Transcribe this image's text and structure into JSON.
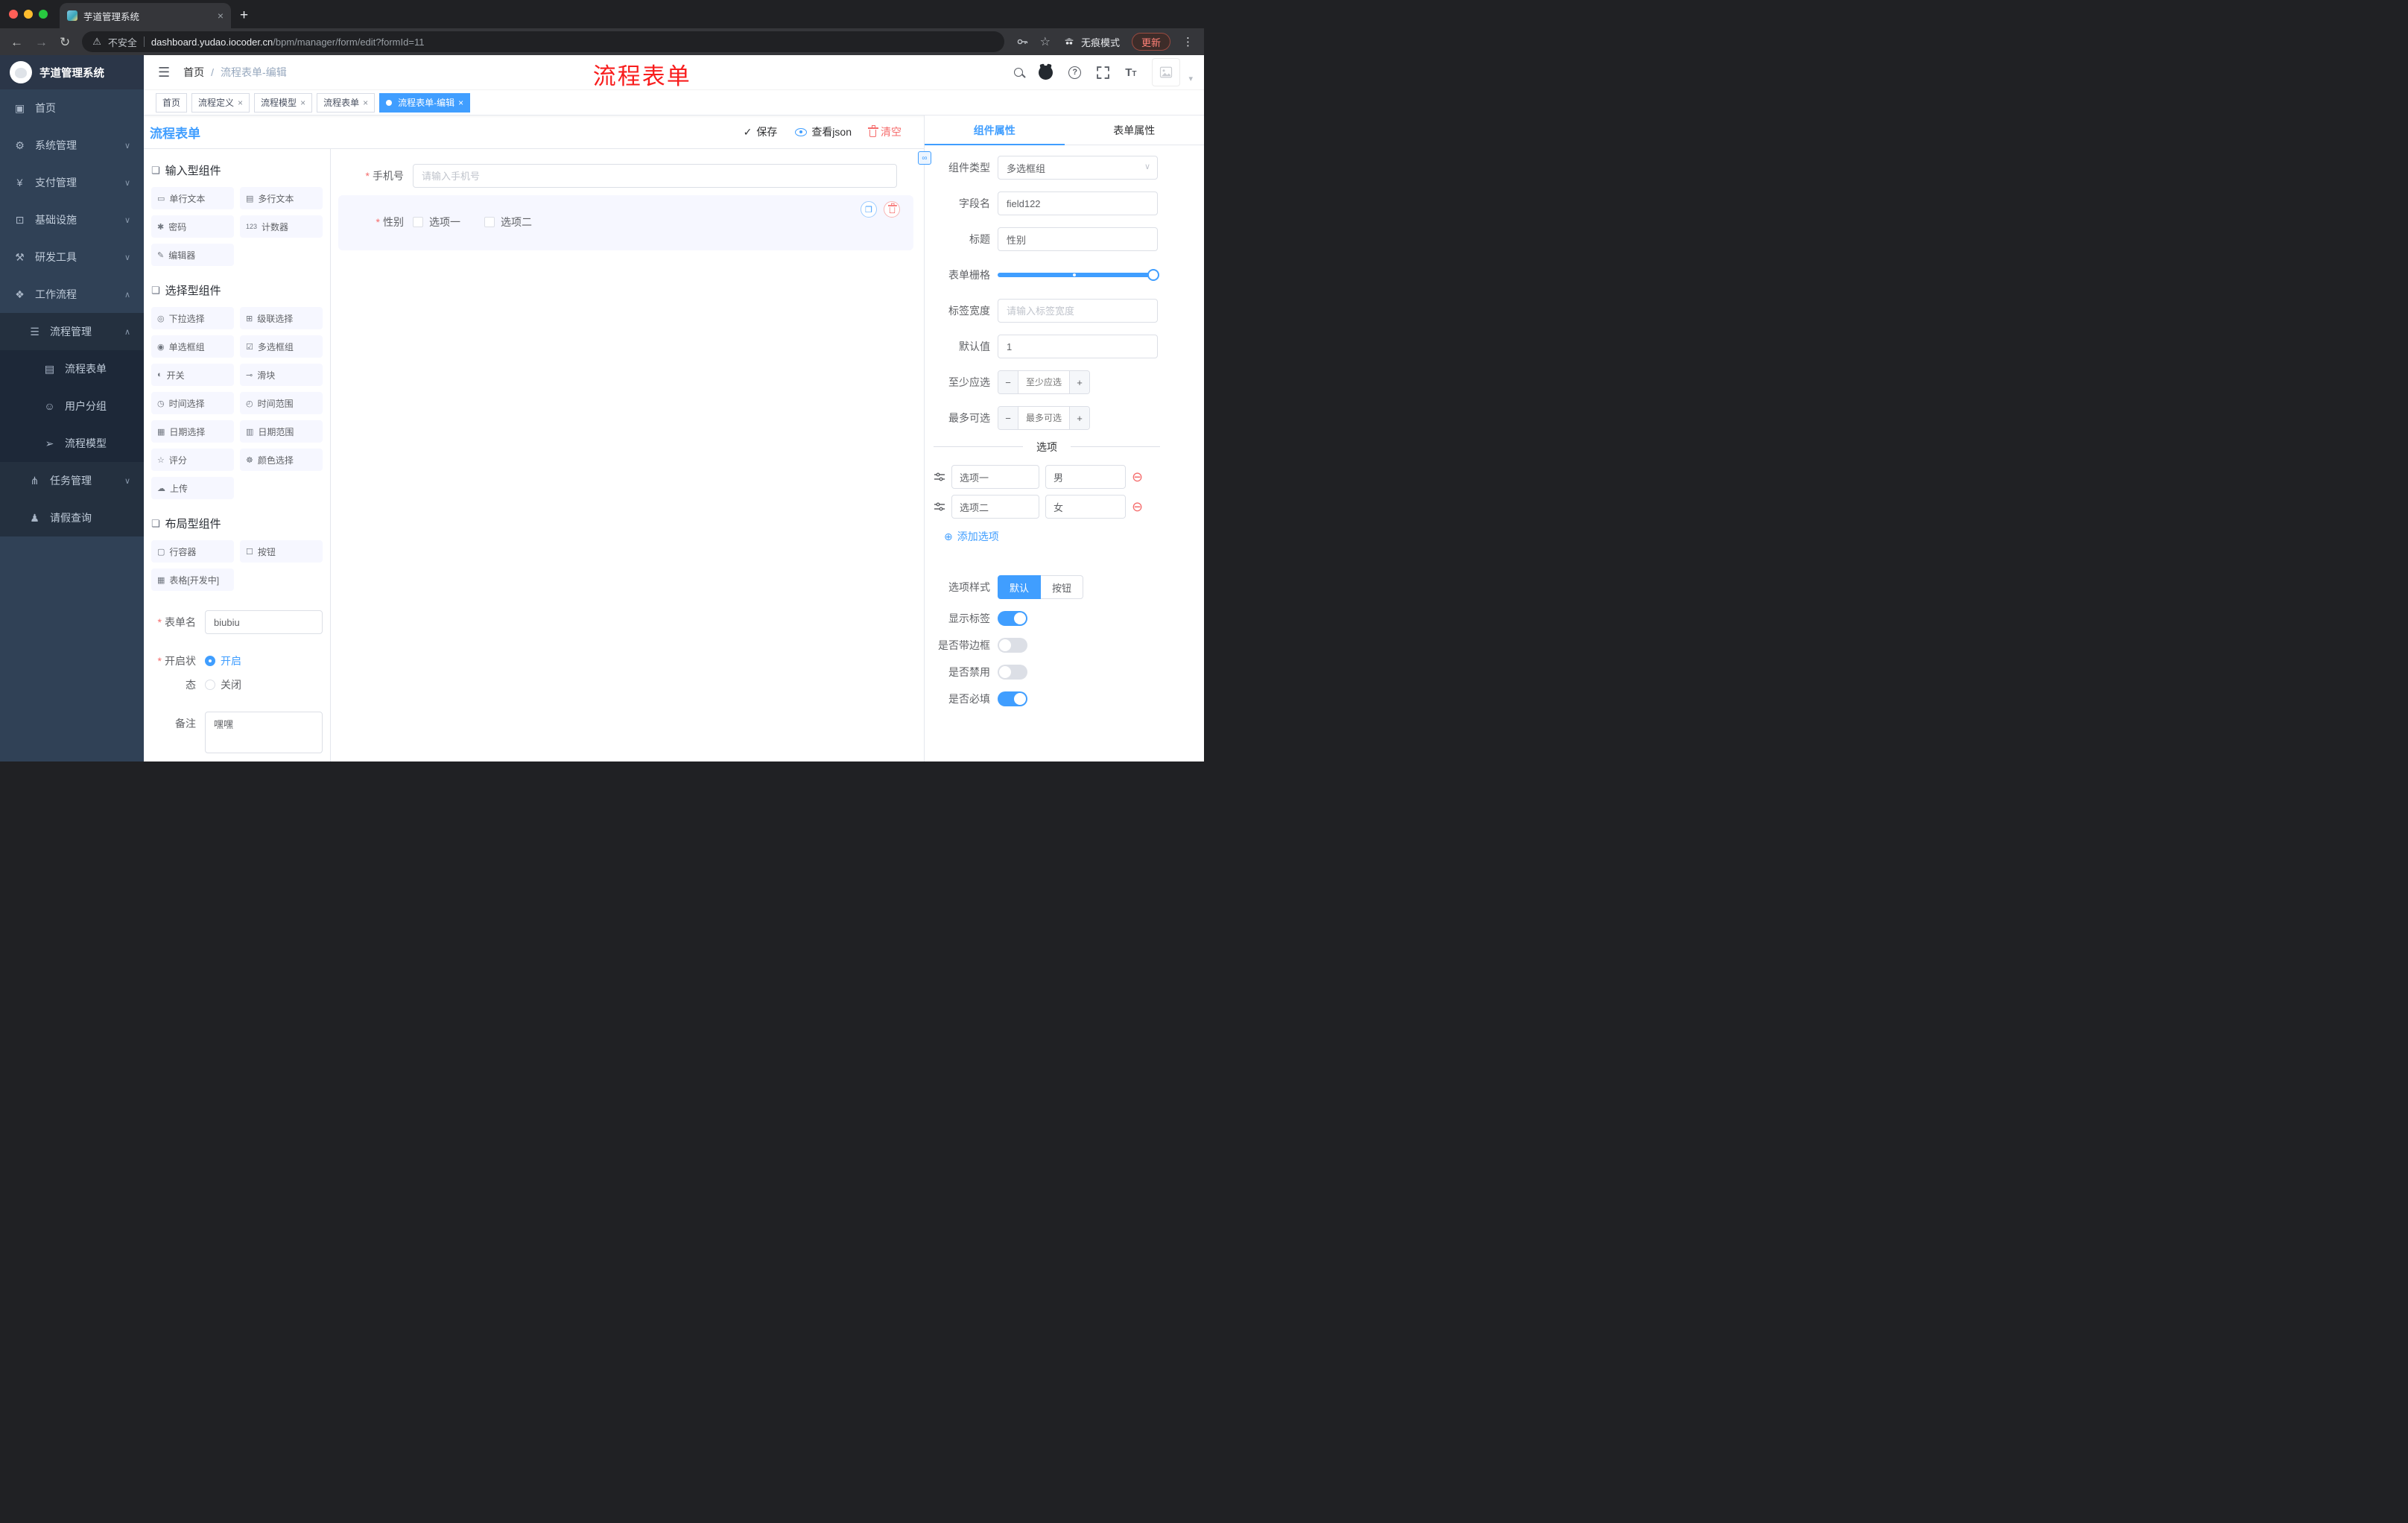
{
  "colors": {
    "accent": "#409eff",
    "danger": "#f56c6c",
    "annotation_red": "#f81d1d",
    "sidebar_bg": "#304156",
    "active_tag": "#409eff"
  },
  "icons": {
    "close": "×",
    "plus": "+",
    "back": "←",
    "forward": "→",
    "refresh": "↻",
    "warning": "⚠",
    "star": "☆",
    "kebab": "⋮",
    "hamburger": "☰",
    "caret_down": "▾",
    "select_caret": "∨",
    "section": "❏",
    "copy": "❐",
    "add": "⊕",
    "remove": "⊖",
    "link": "∞",
    "check": "✓",
    "minus": "−",
    "plus_small": "+",
    "question": "?"
  },
  "browser": {
    "tab_title": "芋道管理系统",
    "security_label": "不安全",
    "url_host": "dashboard.yudao.iocoder.cn",
    "url_path": "/bpm/manager/form/edit?formId=11",
    "incognito_label": "无痕模式",
    "update_button": "更新"
  },
  "sidebar": {
    "title": "芋道管理系统",
    "items": [
      {
        "icon": "▣",
        "label": "首页"
      },
      {
        "icon": "⚙",
        "label": "系统管理",
        "chevron": "∨"
      },
      {
        "icon": "¥",
        "label": "支付管理",
        "chevron": "∨"
      },
      {
        "icon": "⊡",
        "label": "基础设施",
        "chevron": "∨"
      },
      {
        "icon": "⚒",
        "label": "研发工具",
        "chevron": "∨"
      },
      {
        "icon": "❖",
        "label": "工作流程",
        "chevron": "∧"
      },
      {
        "icon": "☰",
        "label": "流程管理",
        "chevron": "∧"
      },
      {
        "icon": "▤",
        "label": "流程表单"
      },
      {
        "icon": "☺",
        "label": "用户分组"
      },
      {
        "icon": "➢",
        "label": "流程模型"
      },
      {
        "icon": "⋔",
        "label": "任务管理",
        "chevron": "∨"
      },
      {
        "icon": "♟",
        "label": "请假查询"
      }
    ]
  },
  "header": {
    "breadcrumb_home": "首页",
    "breadcrumb_sep": "/",
    "breadcrumb_current": "流程表单-编辑",
    "annotation_title": "流程表单"
  },
  "tags": {
    "items": [
      {
        "label": "首页"
      },
      {
        "label": "流程定义"
      },
      {
        "label": "流程模型"
      },
      {
        "label": "流程表单"
      },
      {
        "label": "流程表单-编辑"
      }
    ]
  },
  "designer": {
    "title": "流程表单",
    "actions": {
      "save": "保存",
      "view": "查看json",
      "clear": "清空"
    },
    "palette": {
      "sections": [
        {
          "title": "输入型组件",
          "items": [
            {
              "icon": "▭",
              "label": "单行文本"
            },
            {
              "icon": "▤",
              "label": "多行文本"
            },
            {
              "icon": "✱",
              "label": "密码"
            },
            {
              "icon": "123",
              "label": "计数器"
            },
            {
              "icon": "✎",
              "label": "编辑器"
            }
          ]
        },
        {
          "title": "选择型组件",
          "items": [
            {
              "icon": "◎",
              "label": "下拉选择"
            },
            {
              "icon": "⊞",
              "label": "级联选择"
            },
            {
              "icon": "◉",
              "label": "单选框组"
            },
            {
              "icon": "☑",
              "label": "多选框组"
            },
            {
              "icon": "◐",
              "label": "开关"
            },
            {
              "icon": "⊸",
              "label": "滑块"
            },
            {
              "icon": "◷",
              "label": "时间选择"
            },
            {
              "icon": "◴",
              "label": "时间范围"
            },
            {
              "icon": "▦",
              "label": "日期选择"
            },
            {
              "icon": "▥",
              "label": "日期范围"
            },
            {
              "icon": "☆",
              "label": "评分"
            },
            {
              "icon": "☸",
              "label": "颜色选择"
            },
            {
              "icon": "☁",
              "label": "上传"
            }
          ]
        },
        {
          "title": "布局型组件",
          "items": [
            {
              "icon": "▢",
              "label": "行容器"
            },
            {
              "icon": "☐",
              "label": "按钮"
            },
            {
              "icon": "▦",
              "label": "表格[开发中]"
            }
          ]
        }
      ]
    },
    "meta": {
      "name_label": "表单名",
      "name_value": "biubiu",
      "status_label": "开启状态",
      "status_on": "开启",
      "status_off": "关闭",
      "remark_label": "备注",
      "remark_value": "嘿嘿"
    },
    "canvas": {
      "phone_label": "手机号",
      "phone_placeholder": "请输入手机号",
      "gender_label": "性别",
      "gender_option_1": "选项一",
      "gender_option_2": "选项二"
    }
  },
  "props": {
    "tabs": {
      "component": "组件属性",
      "form": "表单属性"
    },
    "type_label": "组件类型",
    "type_value": "多选框组",
    "field_label": "字段名",
    "field_value": "field122",
    "title_label": "标题",
    "title_value": "性别",
    "grid_label": "表单栅格",
    "width_label": "标签宽度",
    "width_placeholder": "请输入标签宽度",
    "default_label": "默认值",
    "default_value": "1",
    "min_label": "至少应选",
    "min_placeholder": "至少应选",
    "max_label": "最多可选",
    "max_placeholder": "最多可选",
    "options_title": "选项",
    "options": [
      {
        "name": "选项一",
        "value": "男"
      },
      {
        "name": "选项二",
        "value": "女"
      }
    ],
    "add_option": "添加选项",
    "style_label": "选项样式",
    "style_default": "默认",
    "style_button": "按钮",
    "toggle_show_label": "显示标签",
    "toggle_border": "是否带边框",
    "toggle_disabled": "是否禁用",
    "toggle_required": "是否必填"
  }
}
